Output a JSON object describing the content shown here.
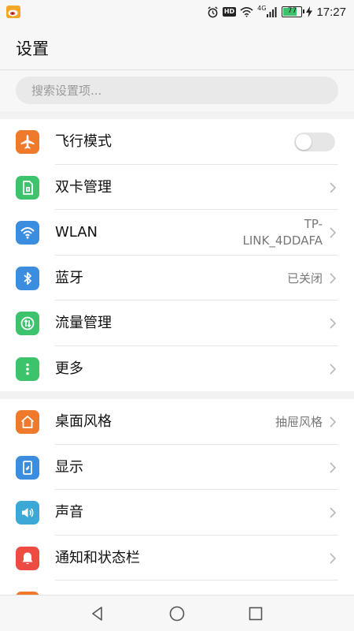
{
  "status_bar": {
    "time": "17:27",
    "battery": "77",
    "network": "4G",
    "hd": "HD"
  },
  "header": {
    "title": "设置"
  },
  "search": {
    "placeholder": "搜索设置项..."
  },
  "section1": {
    "items": [
      {
        "label": "飞行模式",
        "icon": "airplane-icon",
        "color": "#f07a2c",
        "toggle": "off"
      },
      {
        "label": "双卡管理",
        "icon": "sim-card-icon",
        "color": "#3cc36b"
      },
      {
        "label": "WLAN",
        "icon": "wifi-icon",
        "color": "#3b8de0",
        "value_line1": "TP-",
        "value_line2": "LINK_4DDAFA"
      },
      {
        "label": "蓝牙",
        "icon": "bluetooth-icon",
        "color": "#3b8de0",
        "value": "已关闭"
      },
      {
        "label": "流量管理",
        "icon": "data-usage-icon",
        "color": "#3cc36b"
      },
      {
        "label": "更多",
        "icon": "more-icon",
        "color": "#3cc36b"
      }
    ]
  },
  "section2": {
    "items": [
      {
        "label": "桌面风格",
        "icon": "home-style-icon",
        "color": "#f07a2c",
        "value": "抽屉风格"
      },
      {
        "label": "显示",
        "icon": "display-icon",
        "color": "#3b8de0"
      },
      {
        "label": "声音",
        "icon": "sound-icon",
        "color": "#3ba8d6"
      },
      {
        "label": "通知和状态栏",
        "icon": "notification-icon",
        "color": "#ee4b43"
      }
    ]
  },
  "colors": {
    "orange": "#f07a2c",
    "green": "#3cc36b",
    "blue": "#3b8de0",
    "red": "#ee4b43"
  }
}
